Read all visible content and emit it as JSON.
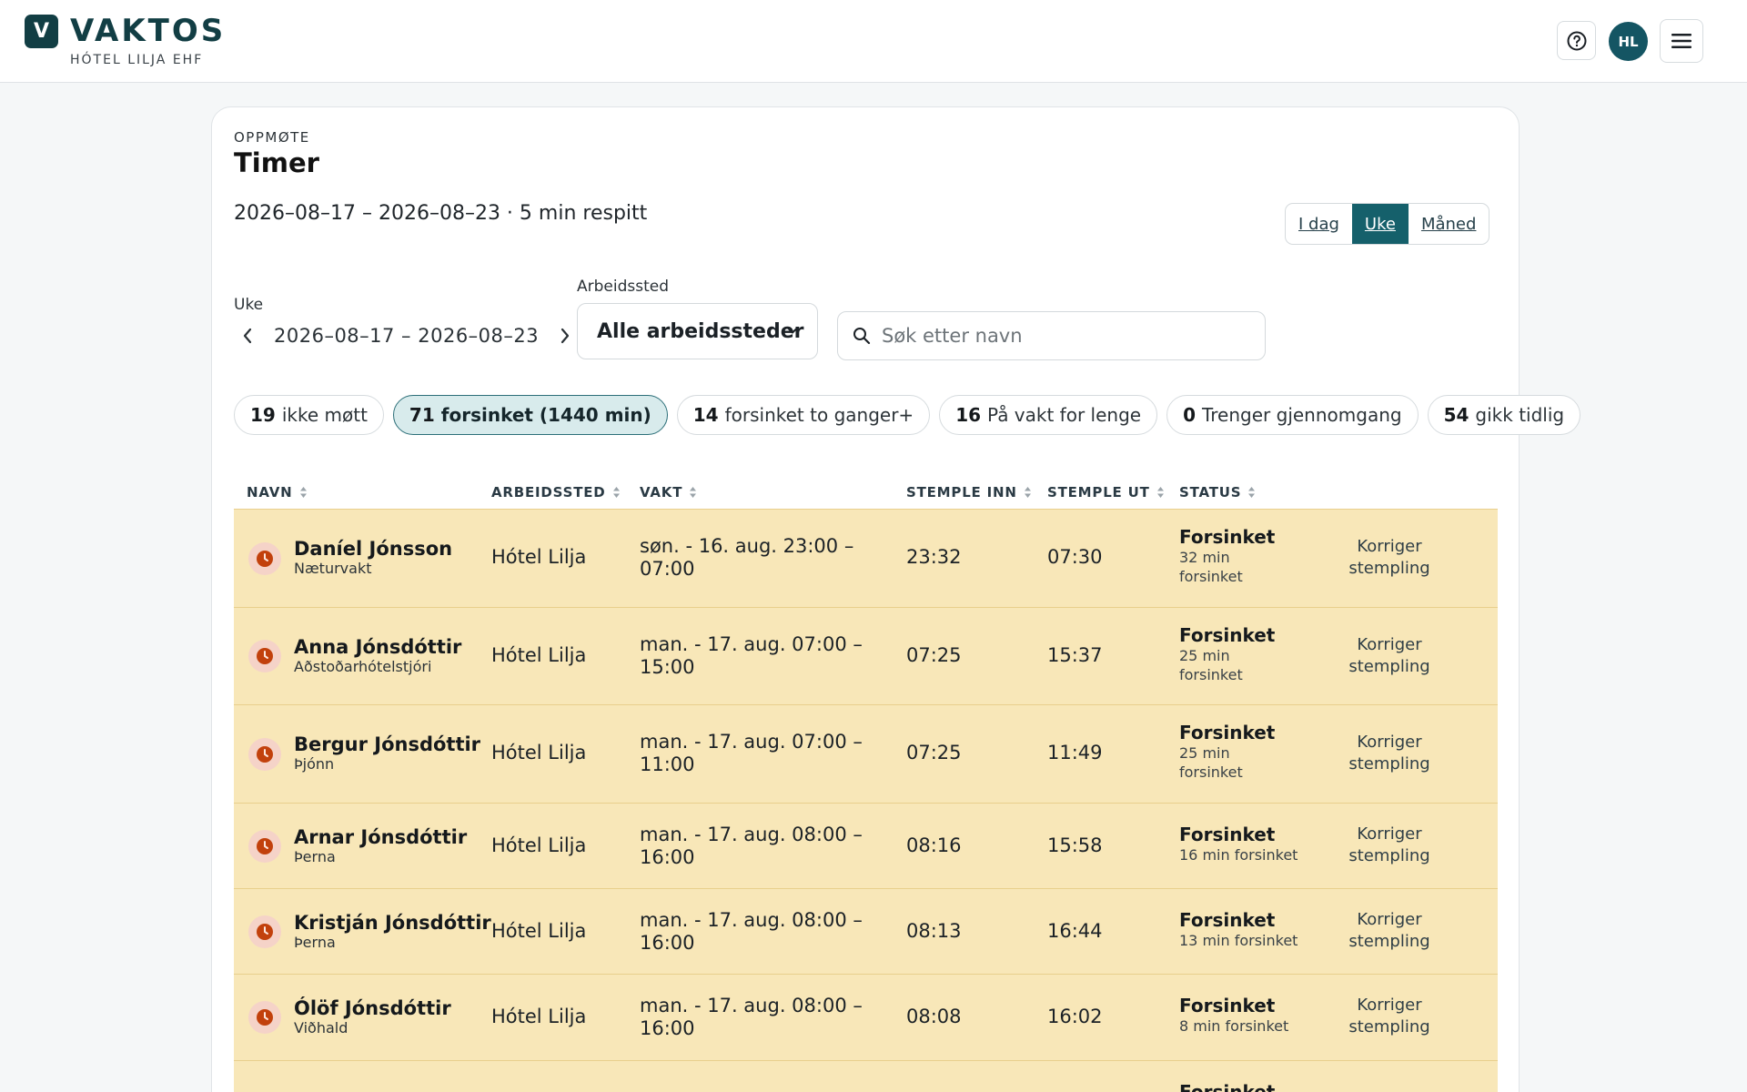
{
  "header": {
    "logo_letter": "V",
    "brand": "VAKTOS",
    "company": "HÓTEL LILJA EHF",
    "avatar_initials": "HL"
  },
  "page": {
    "eyebrow": "OPPMØTE",
    "title": "Timer",
    "subtitle": "2026–08–17 – 2026–08–23 · 5 min respitt"
  },
  "range_tabs": [
    {
      "label": "I dag",
      "active": false
    },
    {
      "label": "Uke",
      "active": true
    },
    {
      "label": "Måned",
      "active": false
    }
  ],
  "filters": {
    "week_label": "Uke",
    "week_value": "2026–08–17 – 2026–08–23",
    "workplace_label": "Arbeidssted",
    "workplace_value": "Alle arbeidssteder",
    "search_placeholder": "Søk etter navn"
  },
  "chips": [
    {
      "count": "19",
      "label": "ikke møtt",
      "active": false
    },
    {
      "count": "71",
      "label": "forsinket (1440 min)",
      "active": true
    },
    {
      "count": "14",
      "label": "forsinket to ganger+",
      "active": false
    },
    {
      "count": "16",
      "label": "På vakt for lenge",
      "active": false
    },
    {
      "count": "0",
      "label": "Trenger gjennomgang",
      "active": false
    },
    {
      "count": "54",
      "label": "gikk tidlig",
      "active": false
    }
  ],
  "columns": {
    "name": "NAVN",
    "workplace": "ARBEIDSSTED",
    "shift": "VAKT",
    "clock_in": "STEMPLE INN",
    "clock_out": "STEMPLE UT",
    "status": "STATUS"
  },
  "rows": [
    {
      "name": "Daníel Jónsson",
      "role": "Næturvakt",
      "workplace": "Hótel Lilja",
      "shift_1": "søn. - 16. aug. 23:00 –",
      "shift_2": "07:00",
      "in": "23:32",
      "out": "07:30",
      "status": "Forsinket",
      "detail_1": "32 min",
      "detail_2": "forsinket",
      "action_1": "Korriger",
      "action_2": "stempling"
    },
    {
      "name": "Anna Jónsdóttir",
      "role": "Aðstoðarhótelstjóri",
      "workplace": "Hótel Lilja",
      "shift_1": "man. - 17. aug. 07:00 –",
      "shift_2": "15:00",
      "in": "07:25",
      "out": "15:37",
      "status": "Forsinket",
      "detail_1": "25 min",
      "detail_2": "forsinket",
      "action_1": "Korriger",
      "action_2": "stempling"
    },
    {
      "name": "Bergur Jónsdóttir",
      "role": "Þjónn",
      "workplace": "Hótel Lilja",
      "shift_1": "man. - 17. aug. 07:00 –",
      "shift_2": "11:00",
      "in": "07:25",
      "out": "11:49",
      "status": "Forsinket",
      "detail_1": "25 min",
      "detail_2": "forsinket",
      "action_1": "Korriger",
      "action_2": "stempling"
    },
    {
      "name": "Arnar Jónsdóttir",
      "role": "Þerna",
      "workplace": "Hótel Lilja",
      "shift_1": "man. - 17. aug. 08:00 –",
      "shift_2": "16:00",
      "in": "08:16",
      "out": "15:58",
      "status": "Forsinket",
      "detail_1": "16 min forsinket",
      "detail_2": "",
      "action_1": "Korriger",
      "action_2": "stempling"
    },
    {
      "name": "Kristján Jónsdóttir",
      "role": "Þerna",
      "workplace": "Hótel Lilja",
      "shift_1": "man. - 17. aug. 08:00 –",
      "shift_2": "16:00",
      "in": "08:13",
      "out": "16:44",
      "status": "Forsinket",
      "detail_1": "13 min forsinket",
      "detail_2": "",
      "action_1": "Korriger",
      "action_2": "stempling"
    },
    {
      "name": "Ólöf Jónsdóttir",
      "role": "Viðhald",
      "workplace": "Hótel Lilja",
      "shift_1": "man. - 17. aug. 08:00 –",
      "shift_2": "16:00",
      "in": "08:08",
      "out": "16:02",
      "status": "Forsinket",
      "detail_1": "8 min forsinket",
      "detail_2": "",
      "action_1": "Korriger",
      "action_2": "stempling"
    },
    {
      "name": "",
      "role": "",
      "workplace": "",
      "shift_1": "",
      "shift_2": "",
      "in": "",
      "out": "",
      "status": "Forsinket",
      "detail_1": "",
      "detail_2": "",
      "action_1": "",
      "action_2": ""
    }
  ],
  "colors": {
    "brand": "#123e44",
    "accent": "#15606b",
    "late_row": "#f8e7b8",
    "late_icon": "#c2410c"
  }
}
